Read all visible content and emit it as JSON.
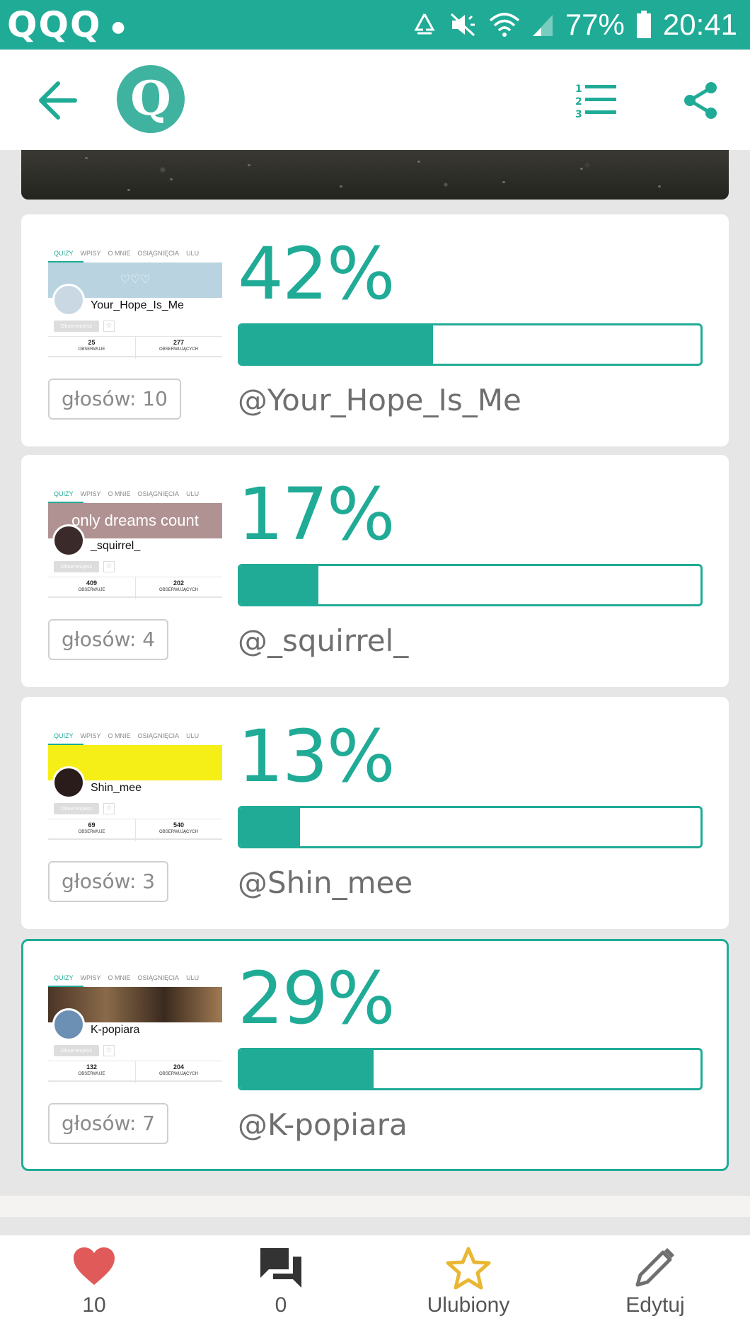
{
  "status_bar": {
    "left_icons": "QQQ",
    "battery": "77%",
    "time": "20:41"
  },
  "header": {
    "logo_letter": "Q"
  },
  "results": [
    {
      "percent": "42%",
      "percent_value": 42,
      "votes": "głosów: 10",
      "handle": "@Your_Hope_Is_Me",
      "selected": false,
      "thumb": {
        "tabs": [
          "QUIZY",
          "WPISY",
          "O MNIE",
          "OSIĄGNIĘCIA",
          "ULU"
        ],
        "banner_text": "♡♡♡",
        "banner_color": "#b9d3e0",
        "avatar_color": "#c9d8e3",
        "username": "Your_Hope_Is_Me",
        "follow": "Obserwujesz",
        "stat1": "25",
        "label1": "OBSERWUJE",
        "stat2": "277",
        "label2": "OBSERWUJĄCYCH"
      }
    },
    {
      "percent": "17%",
      "percent_value": 17,
      "votes": "głosów: 4",
      "handle": "@_squirrel_",
      "selected": false,
      "thumb": {
        "tabs": [
          "QUIZY",
          "WPISY",
          "O MNIE",
          "OSIĄGNIĘCIA",
          "ULU"
        ],
        "banner_text": "only dreams count",
        "banner_color": "#b09292",
        "avatar_color": "#3a2b2a",
        "username": "_squirrel_",
        "follow": "Obserwujesz",
        "stat1": "409",
        "label1": "OBSERWUJE",
        "stat2": "202",
        "label2": "OBSERWUJĄCYCH"
      }
    },
    {
      "percent": "13%",
      "percent_value": 13,
      "votes": "głosów: 3",
      "handle": "@Shin_mee",
      "selected": false,
      "thumb": {
        "tabs": [
          "QUIZY",
          "WPISY",
          "O MNIE",
          "OSIĄGNIĘCIA",
          "ULU"
        ],
        "banner_text": "",
        "banner_color": "#f5ef17",
        "avatar_color": "#2a1c1b",
        "username": "Shin_mee",
        "follow": "Obserwujesz",
        "stat1": "69",
        "label1": "OBSERWUJE",
        "stat2": "540",
        "label2": "OBSERWUJĄCYCH"
      }
    },
    {
      "percent": "29%",
      "percent_value": 29,
      "votes": "głosów: 7",
      "handle": "@K-popiara",
      "selected": true,
      "thumb": {
        "tabs": [
          "QUIZY",
          "WPISY",
          "O MNIE",
          "OSIĄGNIĘCIA",
          "ULU"
        ],
        "banner_text": "",
        "banner_color": "#4a3526",
        "avatar_color": "#6c8fb4",
        "username": "K-popiara",
        "follow": "Obserwujesz",
        "stat1": "132",
        "label1": "OBSERWUJE",
        "stat2": "204",
        "label2": "OBSERWUJĄCYCH"
      }
    }
  ],
  "bottom_nav": {
    "likes": "10",
    "comments": "0",
    "favorite": "Ulubiony",
    "edit": "Edytuj"
  },
  "colors": {
    "accent": "#20ab96",
    "heart": "#e05a5a",
    "star": "#e9b733"
  },
  "icons": [
    "back-arrow-icon",
    "ranking-list-icon",
    "share-icon",
    "heart-icon",
    "comments-icon",
    "star-icon",
    "pencil-icon"
  ]
}
